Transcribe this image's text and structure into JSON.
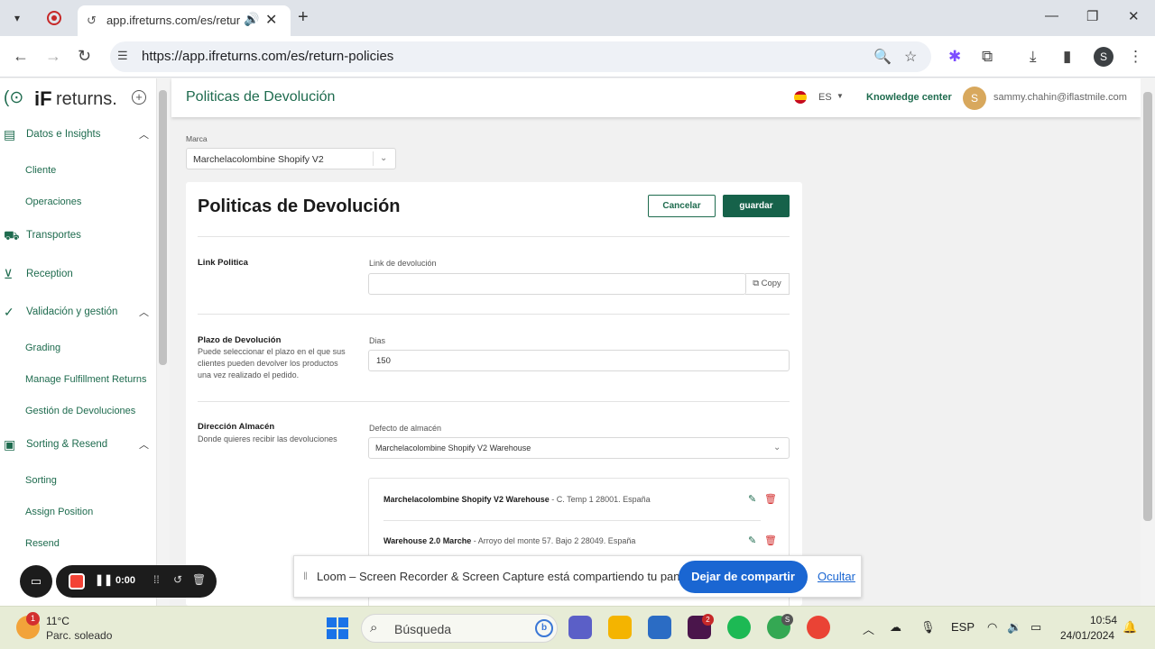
{
  "browser": {
    "tab_title": "app.ifreturns.com/es/return-policies",
    "url": "https://app.ifreturns.com/es/return-policies",
    "profile_initial": "S"
  },
  "sidebar": {
    "logo_if": "iF",
    "logo_returns": "returns.",
    "sections": [
      {
        "label": "Datos e Insights",
        "icon": "chart-icon",
        "items": [
          "Cliente",
          "Operaciones"
        ]
      },
      {
        "label": "Transportes",
        "icon": "truck-icon",
        "items": []
      },
      {
        "label": "Reception",
        "icon": "inbox-icon",
        "items": []
      },
      {
        "label": "Validación y gestión",
        "icon": "check-circle-icon",
        "items": [
          "Grading",
          "Manage Fulfillment Returns",
          "Gestión de Devoluciones"
        ]
      },
      {
        "label": "Sorting & Resend",
        "icon": "box-icon",
        "items": [
          "Sorting",
          "Assign Position",
          "Resend"
        ]
      }
    ]
  },
  "header": {
    "title": "Politicas de Devolución",
    "lang": "ES",
    "knowledge": "Knowledge center",
    "avatar_initial": "S",
    "email": "sammy.chahin@iflastmile.com"
  },
  "marca": {
    "label": "Marca",
    "value": "Marchelacolombine Shopify V2"
  },
  "card": {
    "title": "Politicas de Devolución",
    "cancel": "Cancelar",
    "save": "guardar",
    "link": {
      "title": "Link Politica",
      "field_label": "Link de devolución",
      "value": "",
      "copy": "Copy"
    },
    "plazo": {
      "title": "Plazo de Devolución",
      "desc": "Puede seleccionar el plazo en el que sus clientes pueden devolver los productos una vez realizado el pedido.",
      "field_label": "Dias",
      "value": "150"
    },
    "almacen": {
      "title": "Dirección Almacén",
      "desc": "Donde quieres recibir las devoluciones",
      "field_label": "Defecto de almacén",
      "value": "Marchelacolombine Shopify V2 Warehouse",
      "warehouses": [
        {
          "name": "Marchelacolombine Shopify V2 Warehouse",
          "address": "- C. Temp 1 28001. España"
        },
        {
          "name": "Warehouse 2.0 Marche",
          "address": "- Arroyo del monte 57. Bajo 2 28049. España"
        }
      ]
    }
  },
  "loom": {
    "message": "Loom – Screen Recorder & Screen Capture está compartiendo tu pantalla.",
    "stop": "Dejar de compartir",
    "hide": "Ocultar",
    "timer": "0:00"
  },
  "taskbar": {
    "temp": "11°C",
    "condition": "Parc. soleado",
    "weather_badge": "1",
    "search": "Búsqueda",
    "slack_badge": "2",
    "chrome_badge": "S",
    "lang": "ESP",
    "time": "10:54",
    "date": "24/01/2024"
  },
  "colors": {
    "brand_green": "#16624a",
    "loom_blue": "#1a66d2"
  }
}
